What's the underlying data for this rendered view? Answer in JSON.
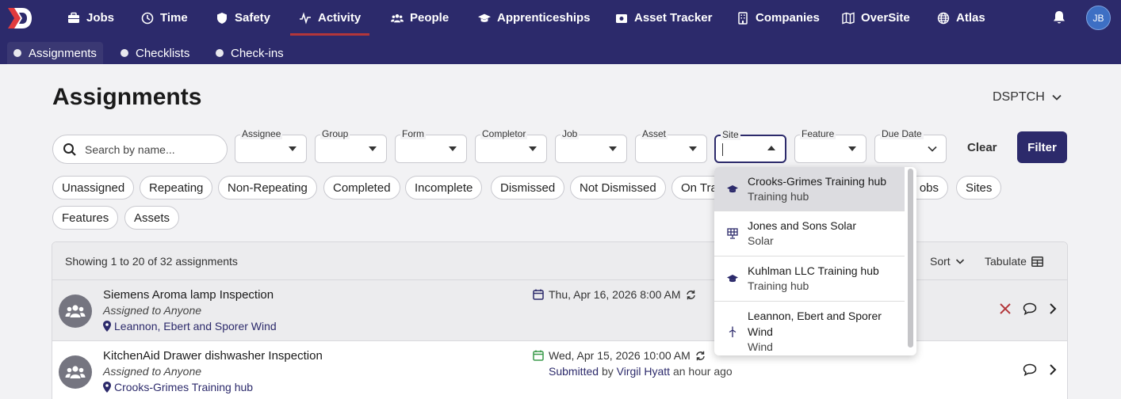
{
  "nav": {
    "items": [
      {
        "label": "Jobs",
        "icon": "briefcase-icon"
      },
      {
        "label": "Time",
        "icon": "clock-icon"
      },
      {
        "label": "Safety",
        "icon": "shield-icon"
      },
      {
        "label": "Activity",
        "icon": "activity-icon",
        "active": true
      },
      {
        "label": "People",
        "icon": "people-icon"
      },
      {
        "label": "Apprenticeships",
        "icon": "graduation-cap-icon"
      },
      {
        "label": "Asset Tracker",
        "icon": "asset-icon"
      },
      {
        "label": "Companies",
        "icon": "building-icon"
      },
      {
        "label": "OverSite",
        "icon": "map-icon"
      },
      {
        "label": "Atlas",
        "icon": "globe-icon"
      }
    ],
    "user_initials": "JB"
  },
  "subnav": {
    "items": [
      {
        "label": "Assignments",
        "active": true
      },
      {
        "label": "Checklists"
      },
      {
        "label": "Check-ins"
      }
    ]
  },
  "page": {
    "title": "Assignments",
    "org": "DSPTCH"
  },
  "filters": {
    "search_placeholder": "Search by name...",
    "assignee": "Assignee",
    "group": "Group",
    "form": "Form",
    "completor": "Completor",
    "job": "Job",
    "asset": "Asset",
    "site": "Site",
    "feature": "Feature",
    "due_date": "Due Date",
    "clear": "Clear",
    "filter": "Filter"
  },
  "chips": {
    "unassigned": "Unassigned",
    "repeating": "Repeating",
    "non_repeating": "Non-Repeating",
    "completed": "Completed",
    "incomplete": "Incomplete",
    "dismissed": "Dismissed",
    "not_dismissed": "Not Dismissed",
    "on_track_partial": "On Tra",
    "jobs_partial": "obs",
    "sites": "Sites",
    "features": "Features",
    "assets": "Assets"
  },
  "list": {
    "showing": "Showing 1 to 20 of 32 assignments",
    "sort": "Sort",
    "tabulate": "Tabulate",
    "rows": [
      {
        "title": "Siemens Aroma lamp Inspection",
        "assigned": "Assigned to Anyone",
        "location": "Leannon, Ebert and Sporer Wind",
        "date": "Thu, Apr 16, 2026 8:00 AM",
        "date_status": "due"
      },
      {
        "title": "KitchenAid Drawer dishwasher Inspection",
        "assigned": "Assigned to Anyone",
        "location": "Crooks-Grimes Training hub",
        "date": "Wed, Apr 15, 2026 10:00 AM",
        "date_status": "submitted",
        "submitted_label": "Submitted",
        "by": "by",
        "submitter": "Virgil Hyatt",
        "when": "an hour ago"
      }
    ]
  },
  "site_dropdown": {
    "options": [
      {
        "name": "Crooks-Grimes Training hub",
        "type": "Training hub",
        "icon": "graduation-cap-icon"
      },
      {
        "name": "Jones and Sons Solar",
        "type": "Solar",
        "icon": "solar-panel-icon"
      },
      {
        "name": "Kuhlman LLC Training hub",
        "type": "Training hub",
        "icon": "graduation-cap-icon"
      },
      {
        "name": "Leannon, Ebert and Sporer Wind",
        "type": "Wind",
        "icon": "wind-turbine-icon"
      }
    ]
  },
  "colors": {
    "brand": "#2c2a6b",
    "accent_underline": "#b3363a",
    "dismiss_red": "#b3363a",
    "calendar_due": "#2c2a6b",
    "calendar_submitted": "#3a9a4a"
  }
}
